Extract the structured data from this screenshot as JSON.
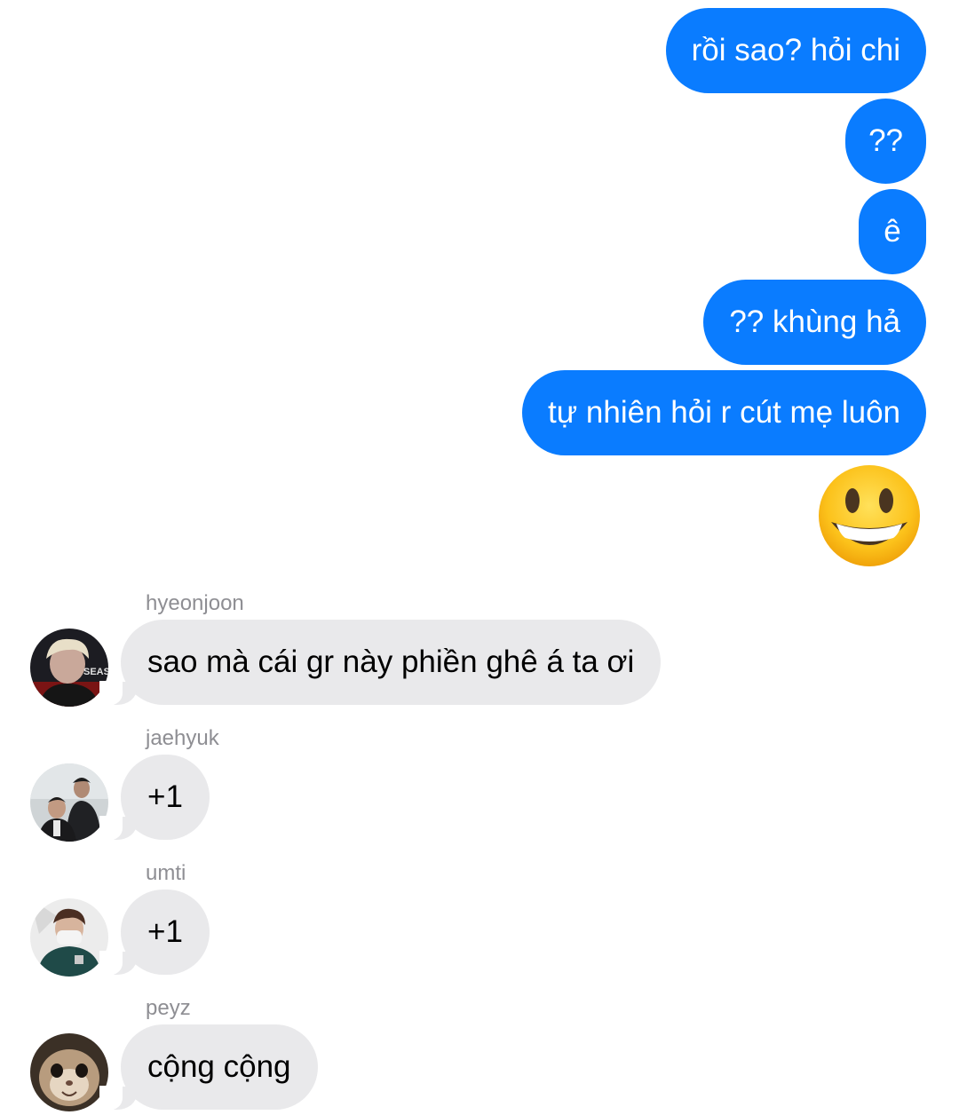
{
  "outgoing": [
    {
      "text": "rồi sao? hỏi chi"
    },
    {
      "text": "??"
    },
    {
      "text": "ê"
    },
    {
      "text": "?? khùng hả"
    },
    {
      "text": "tự nhiên hỏi r cút mẹ luôn"
    }
  ],
  "outgoing_emoji": "smiling-face-emoji",
  "incoming": [
    {
      "sender": "hyeonjoon",
      "text": "sao mà cái gr này phiền ghê á ta ơi",
      "avatar_text": "SEASO"
    },
    {
      "sender": "jaehyuk",
      "text": "+1"
    },
    {
      "sender": "umti",
      "text": "+1"
    },
    {
      "sender": "peyz",
      "text": "cộng cộng"
    }
  ],
  "colors": {
    "outgoing_bubble": "#0a7cff",
    "incoming_bubble": "#e9e9eb",
    "sender_name": "#8e8e93"
  }
}
